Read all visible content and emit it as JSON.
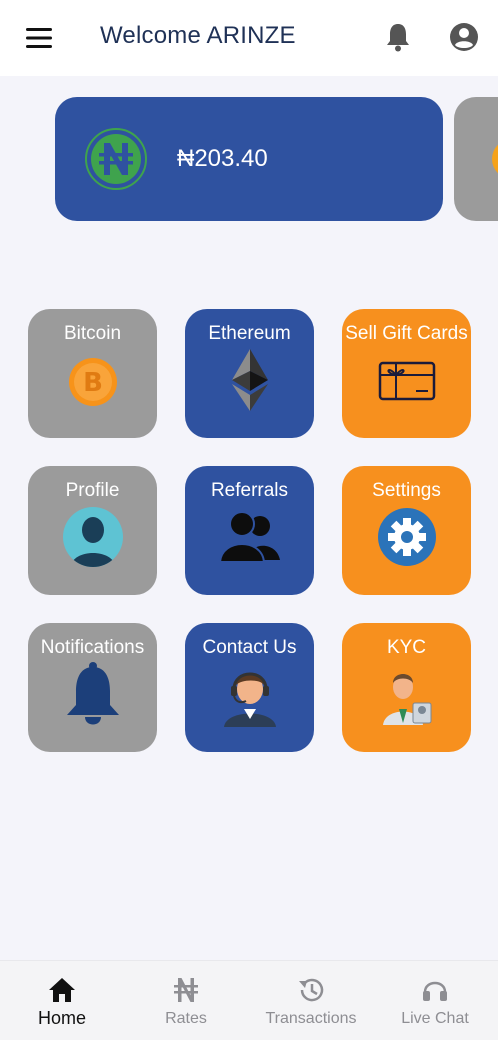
{
  "header": {
    "welcome": "Welcome ARINZE"
  },
  "wallet": {
    "balance": "₦203.40",
    "currency_symbol": "₦"
  },
  "tiles": [
    {
      "label": "Bitcoin",
      "color": "#9b9b9b",
      "icon": "bitcoin-icon"
    },
    {
      "label": "Ethereum",
      "color": "#2f52a0",
      "icon": "ethereum-icon"
    },
    {
      "label": "Sell Gift Cards",
      "color": "#f7901e",
      "icon": "gift-card-icon"
    },
    {
      "label": "Profile",
      "color": "#9b9b9b",
      "icon": "profile-icon"
    },
    {
      "label": "Referrals",
      "color": "#2f52a0",
      "icon": "referrals-icon"
    },
    {
      "label": "Settings",
      "color": "#f7901e",
      "icon": "settings-gear-icon"
    },
    {
      "label": "Notifications",
      "color": "#9b9b9b",
      "icon": "bell-icon"
    },
    {
      "label": "Contact Us",
      "color": "#2f52a0",
      "icon": "support-agent-icon"
    },
    {
      "label": "KYC",
      "color": "#f7901e",
      "icon": "kyc-person-icon"
    }
  ],
  "bottom_nav": [
    {
      "label": "Home",
      "icon": "home-icon",
      "active": true
    },
    {
      "label": "Rates",
      "icon": "naira-icon",
      "active": false
    },
    {
      "label": "Transactions",
      "icon": "history-icon",
      "active": false
    },
    {
      "label": "Live Chat",
      "icon": "headset-icon",
      "active": false
    }
  ],
  "colors": {
    "primary_blue": "#2f52a0",
    "orange": "#f7901e",
    "gray": "#9b9b9b",
    "title": "#1f3156"
  }
}
